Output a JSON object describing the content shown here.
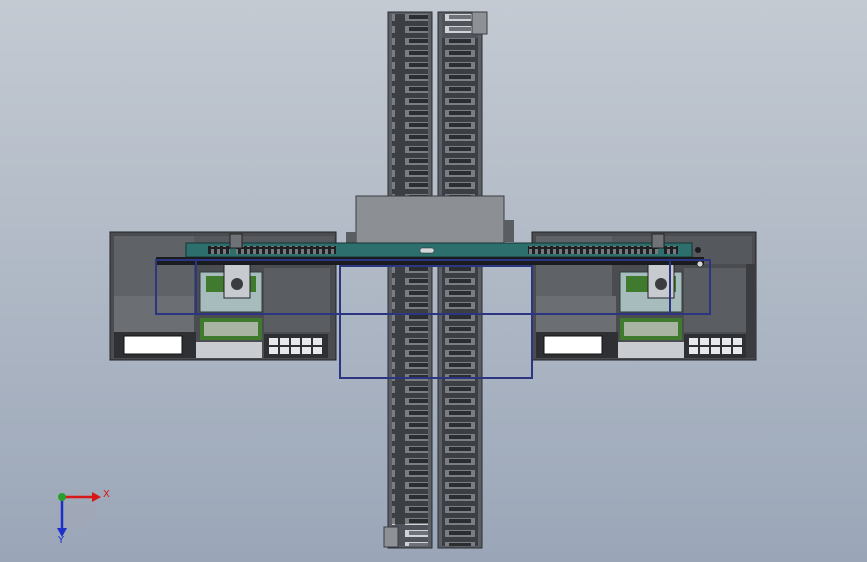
{
  "view": {
    "background_top": "#c4cad2",
    "background_bottom": "#9aa6b8"
  },
  "triad": {
    "x_label": "X",
    "y_label": "Y",
    "x_color": "#d81818",
    "y_color": "#1c2fc8",
    "origin_color": "#2aa02a"
  },
  "colors": {
    "machine_dark": "#4a4c50",
    "machine_mid": "#6b6e73",
    "machine_light": "#8d9095",
    "rail_teal": "#2d6f6d",
    "frame_blue": "#2c3580",
    "conveyor_light": "#b9bec6",
    "pcb_green": "#3f7a2e",
    "panel_white": "#ffffff"
  },
  "machine_modules": [
    {
      "id": "left-module",
      "side": "left"
    },
    {
      "id": "right-module",
      "side": "right"
    }
  ],
  "conveyors": [
    {
      "id": "conveyor-left-lane"
    },
    {
      "id": "conveyor-right-lane"
    }
  ]
}
